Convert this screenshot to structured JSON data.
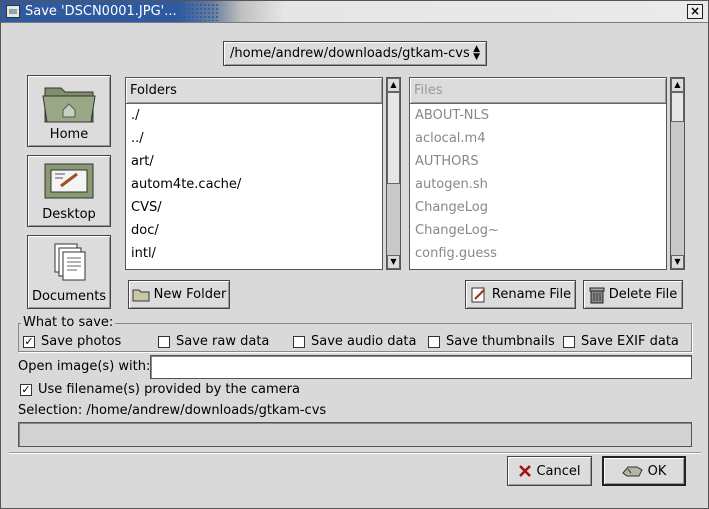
{
  "window": {
    "title": "Save 'DSCN0001.JPG'...",
    "close_label": "×"
  },
  "path_selector": {
    "value": "/home/andrew/downloads/gtkam-cvs",
    "arrows": "▲▼"
  },
  "places": [
    {
      "label": "Home",
      "icon": "home-folder-icon"
    },
    {
      "label": "Desktop",
      "icon": "desktop-icon"
    },
    {
      "label": "Documents",
      "icon": "documents-icon"
    }
  ],
  "folders": {
    "header": "Folders",
    "items": [
      "./",
      "../",
      "art/",
      "autom4te.cache/",
      "CVS/",
      "doc/",
      "intl/"
    ]
  },
  "files": {
    "header": "Files",
    "items": [
      "ABOUT-NLS",
      "aclocal.m4",
      "AUTHORS",
      "autogen.sh",
      "ChangeLog",
      "ChangeLog~",
      "config.guess"
    ]
  },
  "buttons": {
    "new_folder": "New Folder",
    "rename_file": "Rename File",
    "delete_file": "Delete File",
    "cancel": "Cancel",
    "ok": "OK"
  },
  "what_to_save": {
    "legend": "What to save:",
    "options": [
      {
        "label": "Save photos",
        "checked": true
      },
      {
        "label": "Save raw data",
        "checked": false
      },
      {
        "label": "Save audio data",
        "checked": false
      },
      {
        "label": "Save thumbnails",
        "checked": false
      },
      {
        "label": "Save EXIF data",
        "checked": false
      }
    ]
  },
  "open_with": {
    "label": "Open image(s) with:",
    "value": ""
  },
  "use_filenames": {
    "label": "Use filename(s) provided by the camera",
    "checked": true
  },
  "selection": {
    "label": "Selection: /home/andrew/downloads/gtkam-cvs",
    "value": ""
  },
  "colors": {
    "titlebar": "#2f5aa0",
    "window_bg": "#d9d9d9"
  }
}
